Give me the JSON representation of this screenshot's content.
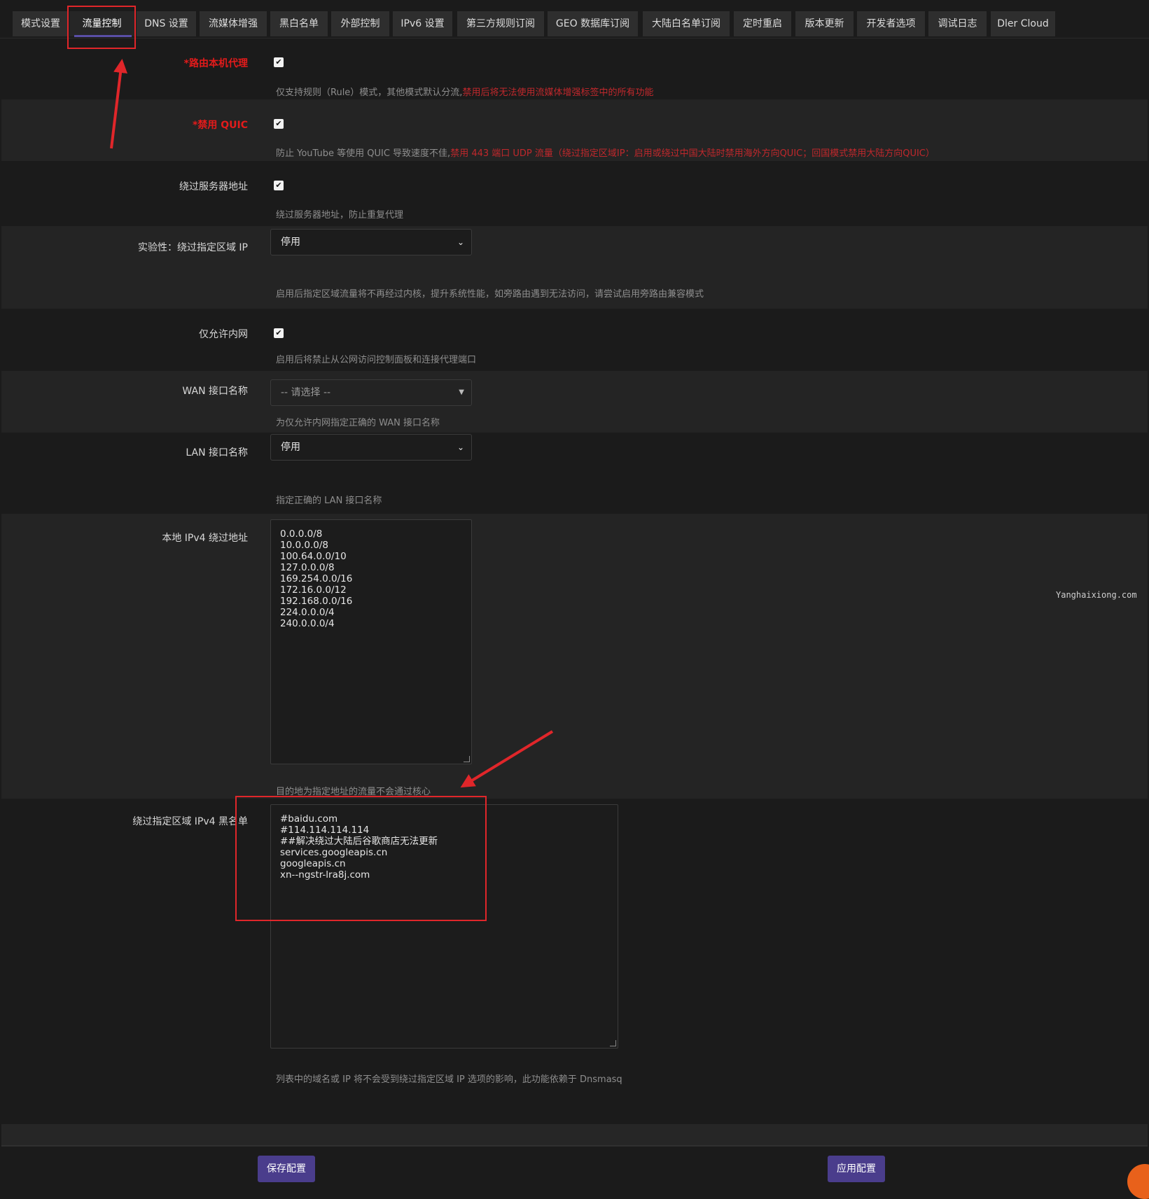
{
  "tabs": [
    {
      "label": "模式设置"
    },
    {
      "label": "流量控制"
    },
    {
      "label": "DNS 设置"
    },
    {
      "label": "流媒体增强"
    },
    {
      "label": "黑白名单"
    },
    {
      "label": "外部控制"
    },
    {
      "label": "IPv6 设置"
    },
    {
      "label": "第三方规则订阅"
    },
    {
      "label": "GEO 数据库订阅"
    },
    {
      "label": "大陆白名单订阅"
    },
    {
      "label": "定时重启"
    },
    {
      "label": "版本更新"
    },
    {
      "label": "开发者选项"
    },
    {
      "label": "调试日志"
    },
    {
      "label": "Dler Cloud"
    }
  ],
  "active_tab": "流量控制",
  "settings": {
    "route_local": {
      "label": "*路由本机代理",
      "checked": true,
      "desc": "仅支持规则（Rule）模式，其他模式默认分流,",
      "warn": "禁用后将无法使用流媒体增强标签中的所有功能"
    },
    "disable_quic": {
      "label": "*禁用 QUIC",
      "checked": true,
      "desc": "防止 YouTube 等使用 QUIC 导致速度不佳,",
      "warn": "禁用 443 端口 UDP 流量（绕过指定区域IP：启用或绕过中国大陆时禁用海外方向QUIC；回国模式禁用大陆方向QUIC）"
    },
    "bypass_server": {
      "label": "绕过服务器地址",
      "checked": true,
      "desc": "绕过服务器地址，防止重复代理"
    },
    "bypass_region_ip": {
      "label": "实验性：绕过指定区域 IP",
      "value": "停用",
      "desc": "启用后指定区域流量将不再经过内核，提升系统性能，如旁路由遇到无法访问，请尝试启用旁路由兼容模式"
    },
    "lan_only": {
      "label": "仅允许内网",
      "checked": true,
      "desc": "启用后将禁止从公网访问控制面板和连接代理端口"
    },
    "wan_iface": {
      "label": "WAN 接口名称",
      "placeholder": "-- 请选择 --",
      "desc": "为仅允许内网指定正确的 WAN 接口名称"
    },
    "lan_iface": {
      "label": "LAN 接口名称",
      "value": "停用",
      "desc": "指定正确的 LAN 接口名称"
    },
    "local_ipv4_bypass": {
      "label": "本地 IPv4 绕过地址",
      "lines": [
        "0.0.0.0/8",
        "10.0.0.0/8",
        "100.64.0.0/10",
        "127.0.0.0/8",
        "169.254.0.0/16",
        "172.16.0.0/12",
        "192.168.0.0/16",
        "224.0.0.0/4",
        "240.0.0.0/4"
      ],
      "desc": "目的地为指定地址的流量不会通过核心"
    },
    "region_ipv4_blacklist": {
      "label": "绕过指定区域 IPv4 黑名单",
      "lines": [
        "#baidu.com",
        "#114.114.114.114",
        "##解决绕过大陆后谷歌商店无法更新",
        "services.googleapis.cn",
        "googleapis.cn",
        "xn--ngstr-lra8j.com"
      ],
      "desc": "列表中的域名或 IP 将不会受到绕过指定区域 IP 选项的影响，此功能依赖于 Dnsmasq"
    }
  },
  "icons": {
    "checkmark": "✔",
    "select_caret": "⌄",
    "dropdown_triangle": "▼"
  },
  "watermark": "Yanghaixiong.com",
  "buttons": {
    "save": "保存配置",
    "apply": "应用配置"
  },
  "colors": {
    "accent": "#4a3d8c",
    "warning": "#c0282c",
    "annotation": "#e0262a"
  }
}
